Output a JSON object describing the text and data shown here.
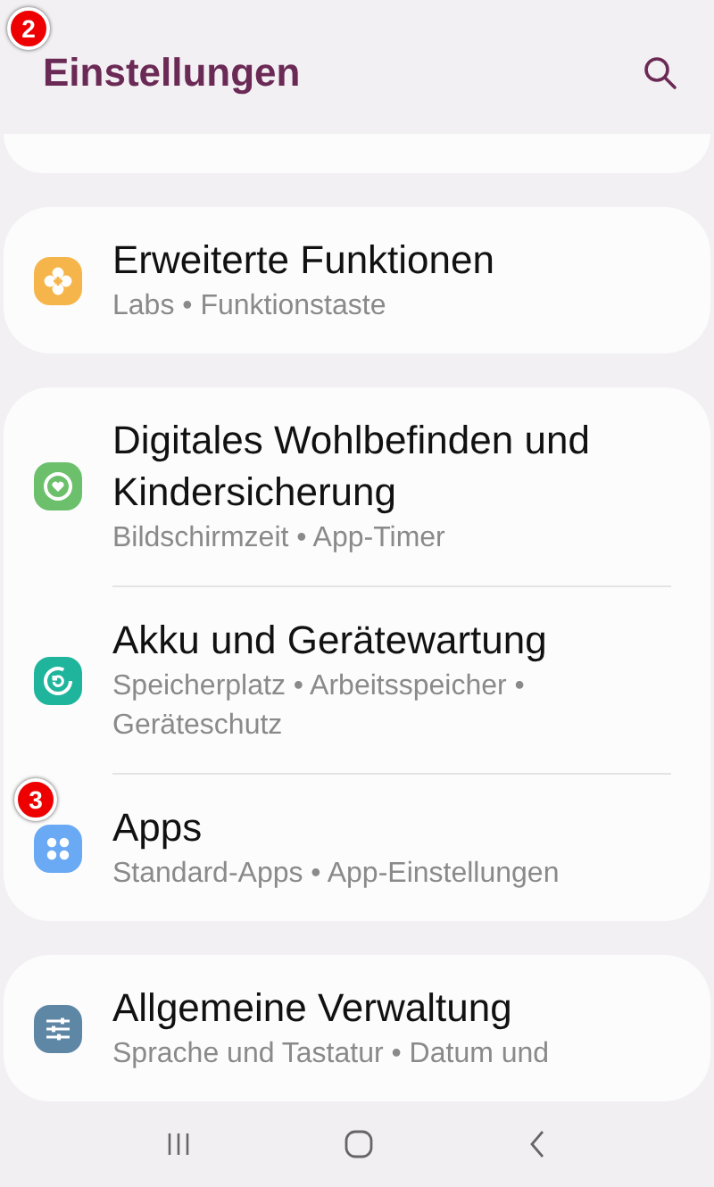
{
  "header": {
    "title": "Einstellungen",
    "marker": "2"
  },
  "groups": [
    {
      "kind": "partial"
    },
    {
      "kind": "card",
      "items": [
        {
          "title": "Erweiterte Funktionen",
          "subtitle": "Labs • Funktionstaste",
          "kind": "flower",
          "color": "#f6b54b"
        }
      ]
    },
    {
      "kind": "card",
      "items": [
        {
          "title": "Digitales Wohlbefinden und Kindersicherung",
          "subtitle": "Bildschirmzeit • App-Timer",
          "kind": "heart",
          "color": "#6cc06c"
        },
        {
          "title": "Akku und Gerätewartung",
          "subtitle": "Speicherplatz • Arbeitsspeicher • Geräteschutz",
          "kind": "refresh",
          "color": "#1fb59c"
        },
        {
          "title": "Apps",
          "subtitle": "Standard-Apps • App-Einstellungen",
          "kind": "dots",
          "color": "#6aa9f4",
          "marker": "3"
        }
      ]
    },
    {
      "kind": "card",
      "items": [
        {
          "title": "Allgemeine Verwaltung",
          "subtitle": "Sprache und Tastatur • Datum und",
          "kind": "sliders",
          "color": "#5e86a5"
        }
      ]
    }
  ]
}
